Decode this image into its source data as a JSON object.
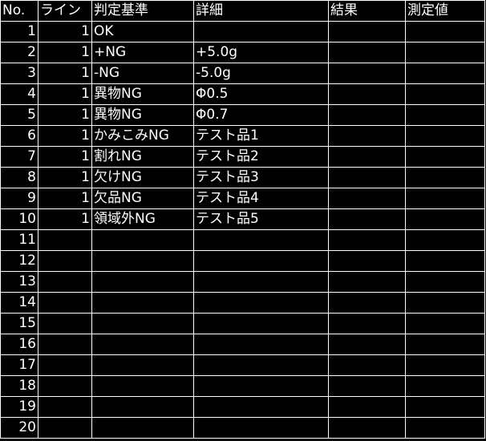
{
  "headers": {
    "no": "No.",
    "line": "ライン",
    "criteria": "判定基準",
    "detail": "詳細",
    "result": "結果",
    "measured": "測定値"
  },
  "rows": [
    {
      "no": "1",
      "line": "1",
      "criteria": "OK",
      "detail": "",
      "result": "",
      "measured": ""
    },
    {
      "no": "2",
      "line": "1",
      "criteria": "+NG",
      "detail": "+5.0g",
      "result": "",
      "measured": ""
    },
    {
      "no": "3",
      "line": "1",
      "criteria": "-NG",
      "detail": "-5.0g",
      "result": "",
      "measured": ""
    },
    {
      "no": "4",
      "line": "1",
      "criteria": "異物NG",
      "detail": "Φ0.5",
      "result": "",
      "measured": ""
    },
    {
      "no": "5",
      "line": "1",
      "criteria": "異物NG",
      "detail": "Φ0.7",
      "result": "",
      "measured": ""
    },
    {
      "no": "6",
      "line": "1",
      "criteria": "かみこみNG",
      "detail": "テスト品1",
      "result": "",
      "measured": ""
    },
    {
      "no": "7",
      "line": "1",
      "criteria": "割れNG",
      "detail": "テスト品2",
      "result": "",
      "measured": ""
    },
    {
      "no": "8",
      "line": "1",
      "criteria": "欠けNG",
      "detail": "テスト品3",
      "result": "",
      "measured": ""
    },
    {
      "no": "9",
      "line": "1",
      "criteria": "欠品NG",
      "detail": "テスト品4",
      "result": "",
      "measured": ""
    },
    {
      "no": "10",
      "line": "1",
      "criteria": "領域外NG",
      "detail": "テスト品5",
      "result": "",
      "measured": ""
    },
    {
      "no": "11",
      "line": "",
      "criteria": "",
      "detail": "",
      "result": "",
      "measured": ""
    },
    {
      "no": "12",
      "line": "",
      "criteria": "",
      "detail": "",
      "result": "",
      "measured": ""
    },
    {
      "no": "13",
      "line": "",
      "criteria": "",
      "detail": "",
      "result": "",
      "measured": ""
    },
    {
      "no": "14",
      "line": "",
      "criteria": "",
      "detail": "",
      "result": "",
      "measured": ""
    },
    {
      "no": "15",
      "line": "",
      "criteria": "",
      "detail": "",
      "result": "",
      "measured": ""
    },
    {
      "no": "16",
      "line": "",
      "criteria": "",
      "detail": "",
      "result": "",
      "measured": ""
    },
    {
      "no": "17",
      "line": "",
      "criteria": "",
      "detail": "",
      "result": "",
      "measured": ""
    },
    {
      "no": "18",
      "line": "",
      "criteria": "",
      "detail": "",
      "result": "",
      "measured": ""
    },
    {
      "no": "19",
      "line": "",
      "criteria": "",
      "detail": "",
      "result": "",
      "measured": ""
    },
    {
      "no": "20",
      "line": "",
      "criteria": "",
      "detail": "",
      "result": "",
      "measured": ""
    }
  ],
  "colors": {
    "background": "#000000",
    "text": "#ffffff",
    "gridline": "#ffffff"
  }
}
